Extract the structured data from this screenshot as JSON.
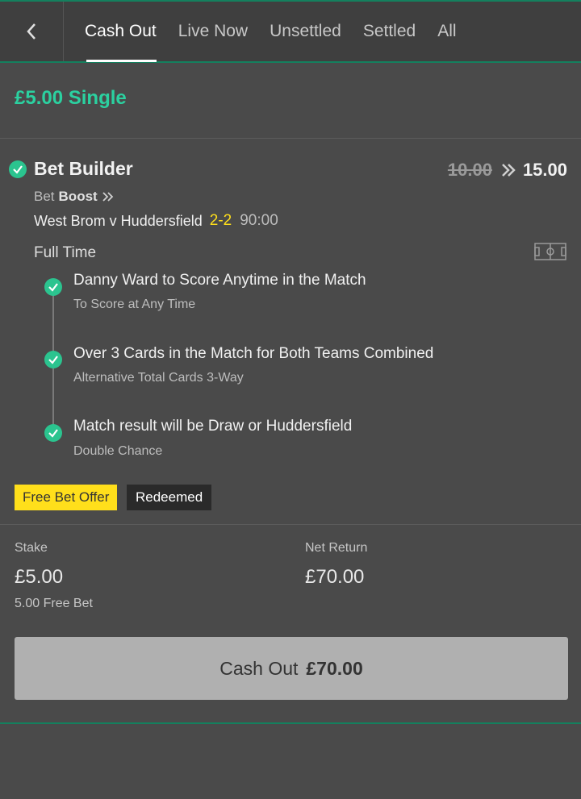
{
  "nav": {
    "back_icon": "chevron-left-icon",
    "tabs": [
      {
        "label": "Cash Out",
        "active": true
      },
      {
        "label": "Live Now",
        "active": false
      },
      {
        "label": "Unsettled",
        "active": false
      },
      {
        "label": "Settled",
        "active": false
      },
      {
        "label": "All",
        "active": false
      }
    ]
  },
  "bet": {
    "title": "£5.00 Single",
    "builder_title": "Bet Builder",
    "odds_old": "10.00",
    "odds_new": "15.00",
    "boost_prefix": "Bet",
    "boost_label": "Boost",
    "match": "West Brom v Huddersfield",
    "score": "2-2",
    "time": "90:00",
    "market": "Full Time",
    "selections": [
      {
        "title": "Danny Ward to Score Anytime in the Match",
        "subtitle": "To Score at Any Time"
      },
      {
        "title": "Over 3 Cards in the Match for Both Teams Combined",
        "subtitle": "Alternative Total Cards 3-Way"
      },
      {
        "title": "Match result will be Draw or Huddersfield",
        "subtitle": "Double Chance"
      }
    ],
    "badges": {
      "offer": "Free Bet Offer",
      "redeemed": "Redeemed"
    }
  },
  "summary": {
    "stake_label": "Stake",
    "stake_value": "£5.00",
    "free_bet_note": "5.00 Free Bet",
    "return_label": "Net Return",
    "return_value": "£70.00"
  },
  "cashout": {
    "label": "Cash Out",
    "amount": "£70.00"
  },
  "colors": {
    "accent": "#2bd1a0",
    "brand_green": "#14805e",
    "score_yellow": "#ffdf1b",
    "background": "#4a4a4a"
  }
}
